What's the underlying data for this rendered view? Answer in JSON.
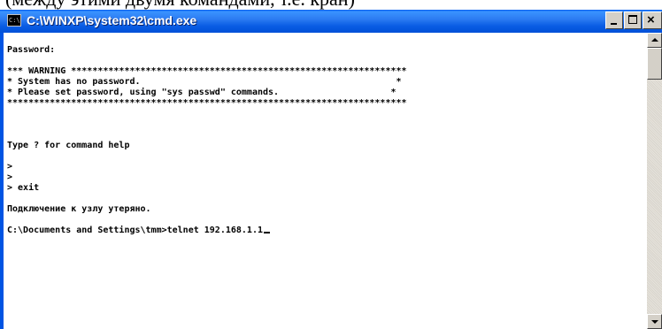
{
  "caption_fragment": "(между этими двумя командами, т.е. кран)",
  "window": {
    "title": "C:\\WINXP\\system32\\cmd.exe",
    "icon": "console-icon",
    "icon_label": "C:\\",
    "controls": {
      "minimize": "minimize-icon",
      "maximize": "maximize-icon",
      "close": "close-icon",
      "close_glyph": "×"
    }
  },
  "console": {
    "lines": [
      "Password:",
      "",
      "*** WARNING ***************************************************************",
      "* System has no password.                                                *",
      "* Please set password, using \"sys passwd\" commands.                     *",
      "***************************************************************************",
      "",
      "",
      "",
      "Type ? for command help",
      "",
      ">",
      ">",
      "> exit",
      "",
      "Подключение к узлу утеряно.",
      "",
      "C:\\Documents and Settings\\tmm>telnet 192.168.1.1"
    ]
  },
  "scrollbar": {
    "up_icon": "arrow-up-icon",
    "down_icon": "arrow-down-icon",
    "position": 0.0
  }
}
